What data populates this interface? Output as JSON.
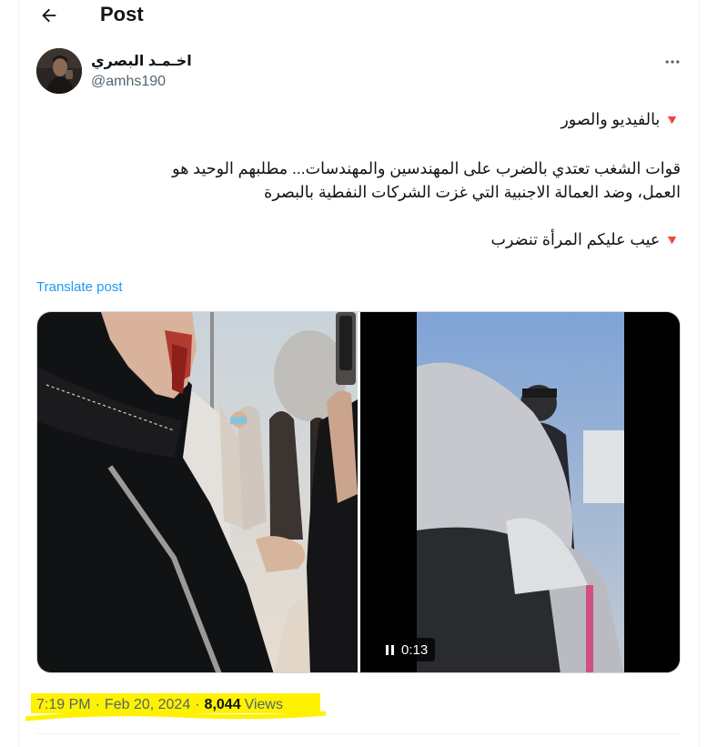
{
  "header": {
    "title": "Post"
  },
  "author": {
    "display_name": "اخـمـد البصري",
    "handle": "@amhs190"
  },
  "post": {
    "line1_marker": "🔻",
    "line1": "بالفيديو والصور",
    "line2a": "قوات الشغب تعتدي بالضرب على المهندسين والمهندسات... مطلبهم الوحيد هو",
    "line2b": "العمل، وضد العمالة الاجنبية التي غزت الشركات النفطية بالبصرة",
    "line3_marker": "🔻",
    "line3": "عيب عليكم المرأة تنضرب"
  },
  "translate_label": "Translate post",
  "media": {
    "video_duration": "0:13"
  },
  "meta": {
    "time": "7:19 PM",
    "separator": "·",
    "date": "Feb 20, 2024",
    "views_count": "8,044",
    "views_label": "Views"
  },
  "colors": {
    "accent_link": "#1d9bf0",
    "marker_red": "#e0566d",
    "highlight": "#fff200",
    "muted_text": "#536471"
  }
}
